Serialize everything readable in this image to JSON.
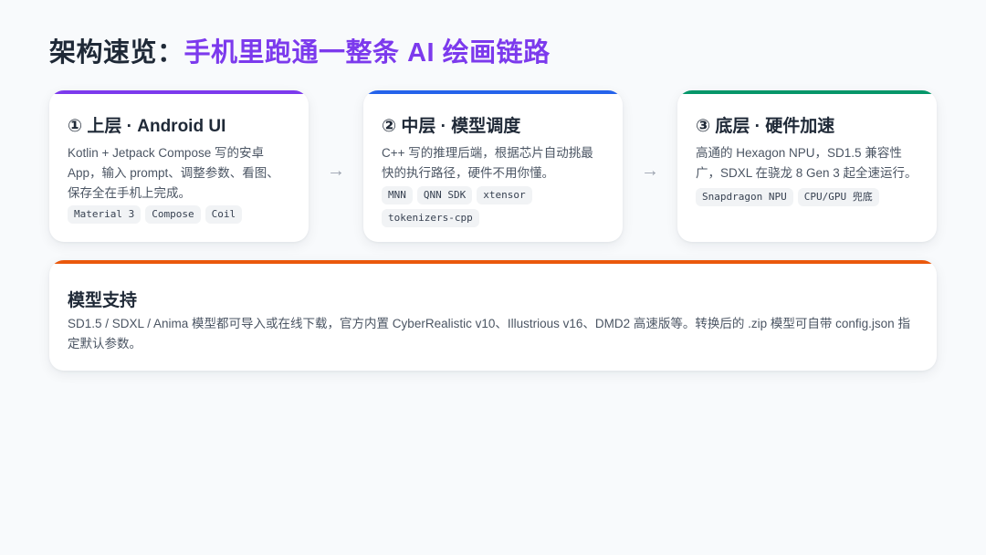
{
  "heading": {
    "prefix": "架构速览：",
    "highlight": "手机里跑通一整条 AI 绘画链路"
  },
  "colors": {
    "accent": "#7c3aed",
    "card1_bar": "#7c3aed",
    "card2_bar": "#2563eb",
    "card3_bar": "#059669",
    "card4_bar": "#ea580c"
  },
  "arrows": [
    "→",
    "→"
  ],
  "cards": [
    {
      "title": "① 上层 · Android UI",
      "text": "Kotlin + Jetpack Compose 写的安卓 App，输入 prompt、调整参数、看图、保存全在手机上完成。",
      "tags": [
        "Material 3",
        "Compose",
        "Coil"
      ]
    },
    {
      "title": "② 中层 · 模型调度",
      "text": "C++ 写的推理后端，根据芯片自动挑最快的执行路径，硬件不用你懂。",
      "tags": [
        "MNN",
        "QNN SDK",
        "xtensor",
        "tokenizers-cpp"
      ]
    },
    {
      "title": "③ 底层 · 硬件加速",
      "text": "高通的 Hexagon NPU，SD1.5 兼容性广，SDXL 在骁龙 8 Gen 3 起全速运行。",
      "tags": [
        "Snapdragon NPU",
        "CPU/GPU 兜底"
      ]
    }
  ],
  "support": {
    "title": "模型支持",
    "text": "SD1.5 / SDXL / Anima 模型都可导入或在线下载，官方内置 CyberRealistic v10、Illustrious v16、DMD2 高速版等。转换后的 .zip 模型可自带 config.json 指定默认参数。"
  }
}
